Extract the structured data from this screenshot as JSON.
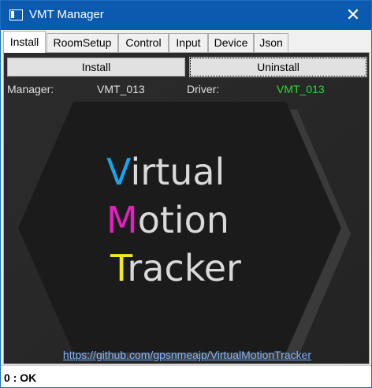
{
  "window": {
    "title": "VMT Manager",
    "icon": "window-app-icon",
    "close_icon": "close-icon"
  },
  "tabs": [
    {
      "label": "Install",
      "active": true
    },
    {
      "label": "RoomSetup"
    },
    {
      "label": "Control"
    },
    {
      "label": "Input"
    },
    {
      "label": "Device"
    },
    {
      "label": "Json"
    }
  ],
  "install_panel": {
    "install_button": "Install",
    "uninstall_button": "Uninstall",
    "manager_label": "Manager:",
    "manager_version": "VMT_013",
    "driver_label": "Driver:",
    "driver_version": "VMT_013",
    "driver_version_color": "#22e022",
    "logo": {
      "line1_initial": "V",
      "line1_rest": "irtual",
      "line2_initial": "M",
      "line2_rest": "otion",
      "line3_initial": "T",
      "line3_rest": "racker",
      "colors": {
        "v": "#1aa3e8",
        "m": "#e81fc0",
        "t": "#f2e81a",
        "rest": "#d9d9d9",
        "hexagon": "#1b1b1b"
      }
    },
    "link": "https://github.com/gpsnmeajp/VirtualMotionTracker"
  },
  "status_bar": {
    "text": "0 : OK"
  }
}
